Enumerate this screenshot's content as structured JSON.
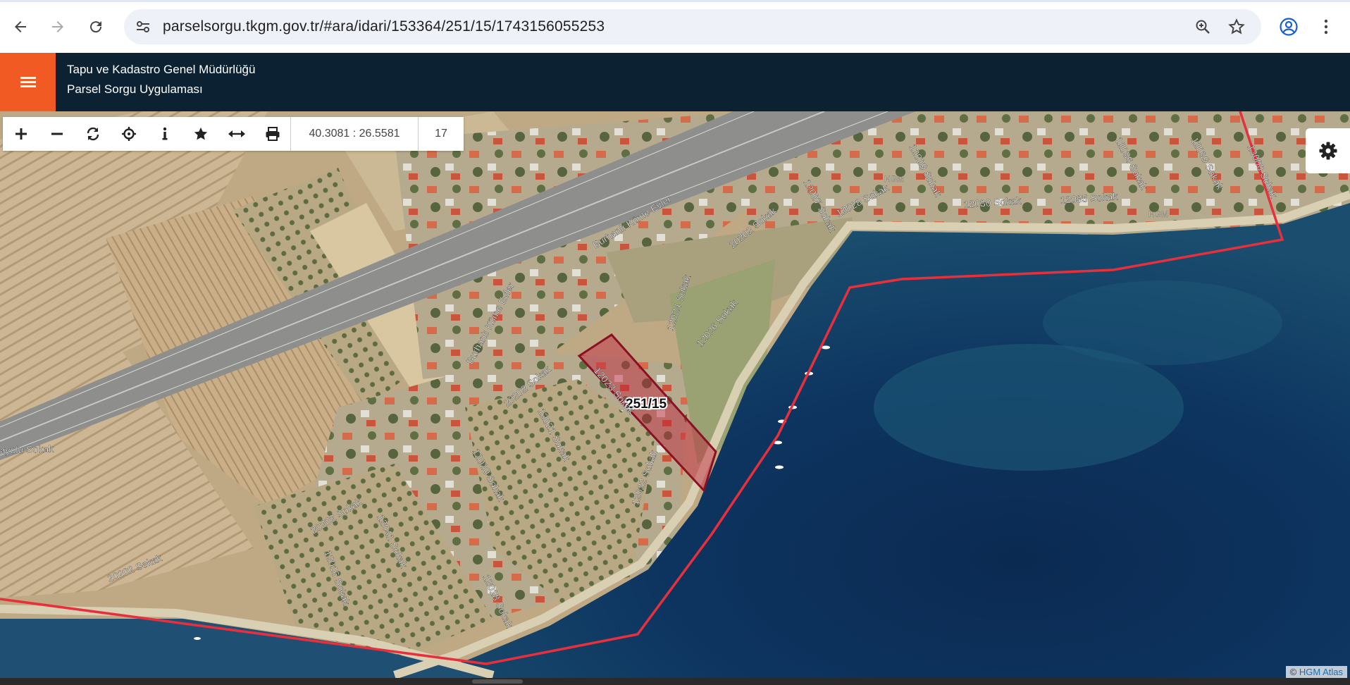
{
  "browser": {
    "url": "parselsorgu.tkgm.gov.tr/#ara/idari/153364/251/15/1743156055253",
    "icons": [
      "back-arrow-icon",
      "forward-arrow-icon",
      "reload-icon",
      "site-settings-icon",
      "zoom-icon",
      "bookmark-star-icon",
      "profile-icon",
      "kebab-menu-icon"
    ]
  },
  "app": {
    "title_line1": "Tapu ve Kadastro Genel Müdürlüğü",
    "title_line2": "Parsel Sorgu Uygulaması",
    "accent_color": "#f15a22",
    "header_color": "#0c2233"
  },
  "toolbar": {
    "coordinates": "40.3081 : 26.5581",
    "zoom_level": "17",
    "icons": [
      "zoom-in-icon",
      "zoom-out-icon",
      "refresh-icon",
      "locate-icon",
      "info-icon",
      "favorite-star-icon",
      "measure-icon",
      "print-icon"
    ]
  },
  "map": {
    "parcel_label": "251/15",
    "parcel_color": "#c0203a",
    "boundary_color": "#e8303c",
    "streets": {
      "s1": "Burhanlı Küme Evler",
      "s2": "Burhanlı Küme Evler",
      "s3": "20202 Sokak",
      "s4": "20202 Sokak",
      "s5": "20202 Sokak",
      "s6": "20202 Sokak",
      "s7": "12029 Sokak",
      "s8": "12027 Sokak",
      "s9": "12028 Sokak",
      "s10": "12030 Sokak",
      "s11": "12035 Sokak",
      "s12": "12036 Sokak",
      "s13": "12039 Sokak",
      "s14": "13000 Sokak",
      "s15": "12026 Sokak",
      "s16": "12023 Sokak",
      "s17": "12024 Sokak",
      "s18": "12021 Sokak",
      "s19": "12022 Sokak",
      "s20": "12020 Sokak",
      "s21": "12041 Sokak",
      "s22": "12016 Sokak",
      "s23": "12018 Sokak",
      "s24": "ayolu Sokak"
    },
    "watermark": "HGM",
    "attribution_prefix": "©",
    "attribution": "HGM Atlas"
  }
}
